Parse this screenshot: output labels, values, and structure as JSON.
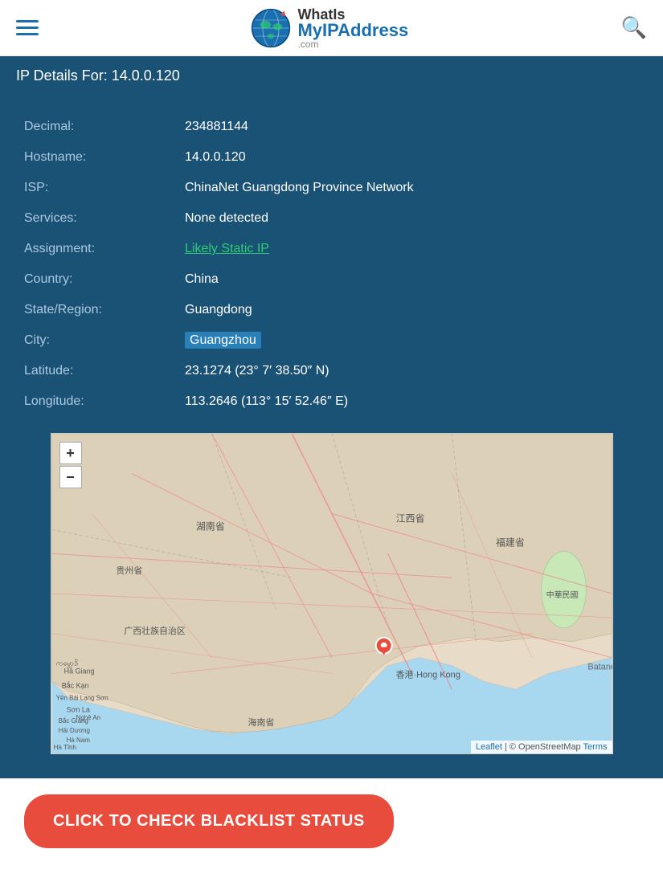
{
  "header": {
    "logo_whatis": "WhatIs",
    "logo_myip": "MyIPAddress",
    "logo_dotcom": ".com",
    "hamburger_label": "Menu",
    "search_label": "Search"
  },
  "ip_details": {
    "title": "IP Details For: 14.0.0.120",
    "rows": [
      {
        "label": "Decimal:",
        "value": "234881144",
        "type": "text"
      },
      {
        "label": "Hostname:",
        "value": "14.0.0.120",
        "type": "text"
      },
      {
        "label": "ISP:",
        "value": "ChinaNet Guangdong Province Network",
        "type": "text"
      },
      {
        "label": "Services:",
        "value": "None detected",
        "type": "text"
      },
      {
        "label": "Assignment:",
        "value": "Likely Static IP",
        "type": "link"
      },
      {
        "label": "Country:",
        "value": "China",
        "type": "text"
      },
      {
        "label": "State/Region:",
        "value": "Guangdong",
        "type": "text"
      },
      {
        "label": "City:",
        "value": "Guangzhou",
        "type": "highlight"
      },
      {
        "label": "Latitude:",
        "value": "23.1274 (23° 7′ 38.50″ N)",
        "type": "text"
      },
      {
        "label": "Longitude:",
        "value": "113.2646 (113° 15′ 52.46″ E)",
        "type": "text"
      }
    ]
  },
  "map": {
    "zoom_plus": "+",
    "zoom_minus": "−",
    "attribution_leaflet": "Leaflet",
    "attribution_osm": "© OpenStreetMap",
    "attribution_terms": "Terms"
  },
  "blacklist": {
    "button_label": "CLICK TO CHECK BLACKLIST STATUS"
  }
}
